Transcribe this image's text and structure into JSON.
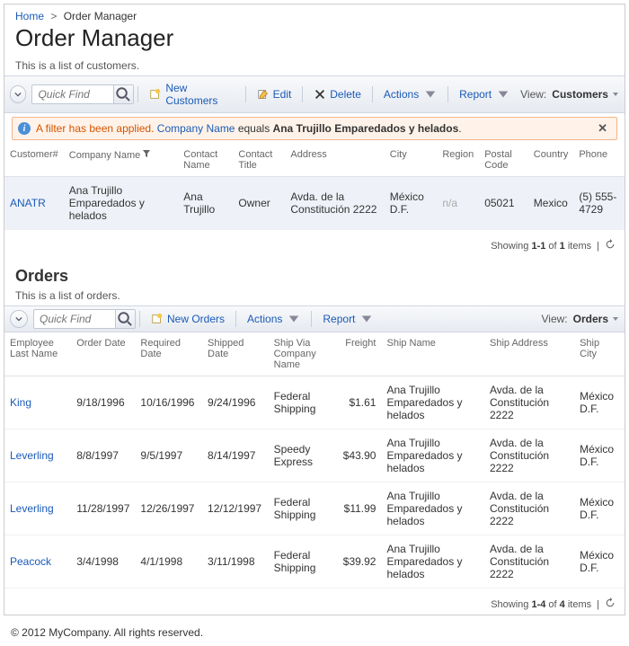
{
  "breadcrumb": {
    "home": "Home",
    "current": "Order Manager"
  },
  "title": "Order Manager",
  "customers": {
    "desc": "This is a list of customers.",
    "quickfind_placeholder": "Quick Find",
    "btn_new": "New Customers",
    "btn_edit": "Edit",
    "btn_delete": "Delete",
    "btn_actions": "Actions",
    "btn_report": "Report",
    "view_label": "View:",
    "view_value": "Customers",
    "filter": {
      "prefix": "A filter has been applied.",
      "field": "Company Name",
      "op": "equals",
      "value": "Ana Trujillo Emparedados y helados"
    },
    "cols": {
      "id": "Customer#",
      "company": "Company Name",
      "contact": "Contact Name",
      "title": "Contact Title",
      "address": "Address",
      "city": "City",
      "region": "Region",
      "postal": "Postal Code",
      "country": "Country",
      "phone": "Phone"
    },
    "rows": [
      {
        "id": "ANATR",
        "company": "Ana Trujillo Emparedados y helados",
        "contact": "Ana Trujillo",
        "title": "Owner",
        "address": "Avda. de la Constitución 2222",
        "city": "México D.F.",
        "region": "n/a",
        "postal": "05021",
        "country": "Mexico",
        "phone": "(5) 555-4729"
      }
    ],
    "pager": {
      "prefix": "Showing",
      "range": "1-1",
      "of": "of",
      "total": "1",
      "suffix": "items"
    }
  },
  "orders": {
    "heading": "Orders",
    "desc": "This is a list of orders.",
    "quickfind_placeholder": "Quick Find",
    "btn_new": "New Orders",
    "btn_actions": "Actions",
    "btn_report": "Report",
    "view_label": "View:",
    "view_value": "Orders",
    "cols": {
      "emp": "Employee Last Name",
      "odate": "Order Date",
      "rdate": "Required Date",
      "sdate": "Shipped Date",
      "shipvia": "Ship Via Company Name",
      "freight": "Freight",
      "shipname": "Ship Name",
      "shipaddr": "Ship Address",
      "shipcity": "Ship City"
    },
    "rows": [
      {
        "emp": "King",
        "odate": "9/18/1996",
        "rdate": "10/16/1996",
        "sdate": "9/24/1996",
        "shipvia": "Federal Shipping",
        "freight": "$1.61",
        "shipname": "Ana Trujillo Emparedados y helados",
        "shipaddr": "Avda. de la Constitución 2222",
        "shipcity": "México D.F."
      },
      {
        "emp": "Leverling",
        "odate": "8/8/1997",
        "rdate": "9/5/1997",
        "sdate": "8/14/1997",
        "shipvia": "Speedy Express",
        "freight": "$43.90",
        "shipname": "Ana Trujillo Emparedados y helados",
        "shipaddr": "Avda. de la Constitución 2222",
        "shipcity": "México D.F."
      },
      {
        "emp": "Leverling",
        "odate": "11/28/1997",
        "rdate": "12/26/1997",
        "sdate": "12/12/1997",
        "shipvia": "Federal Shipping",
        "freight": "$11.99",
        "shipname": "Ana Trujillo Emparedados y helados",
        "shipaddr": "Avda. de la Constitución 2222",
        "shipcity": "México D.F."
      },
      {
        "emp": "Peacock",
        "odate": "3/4/1998",
        "rdate": "4/1/1998",
        "sdate": "3/11/1998",
        "shipvia": "Federal Shipping",
        "freight": "$39.92",
        "shipname": "Ana Trujillo Emparedados y helados",
        "shipaddr": "Avda. de la Constitución 2222",
        "shipcity": "México D.F."
      }
    ],
    "pager": {
      "prefix": "Showing",
      "range": "1-4",
      "of": "of",
      "total": "4",
      "suffix": "items"
    }
  },
  "footer": "© 2012 MyCompany. All rights reserved."
}
